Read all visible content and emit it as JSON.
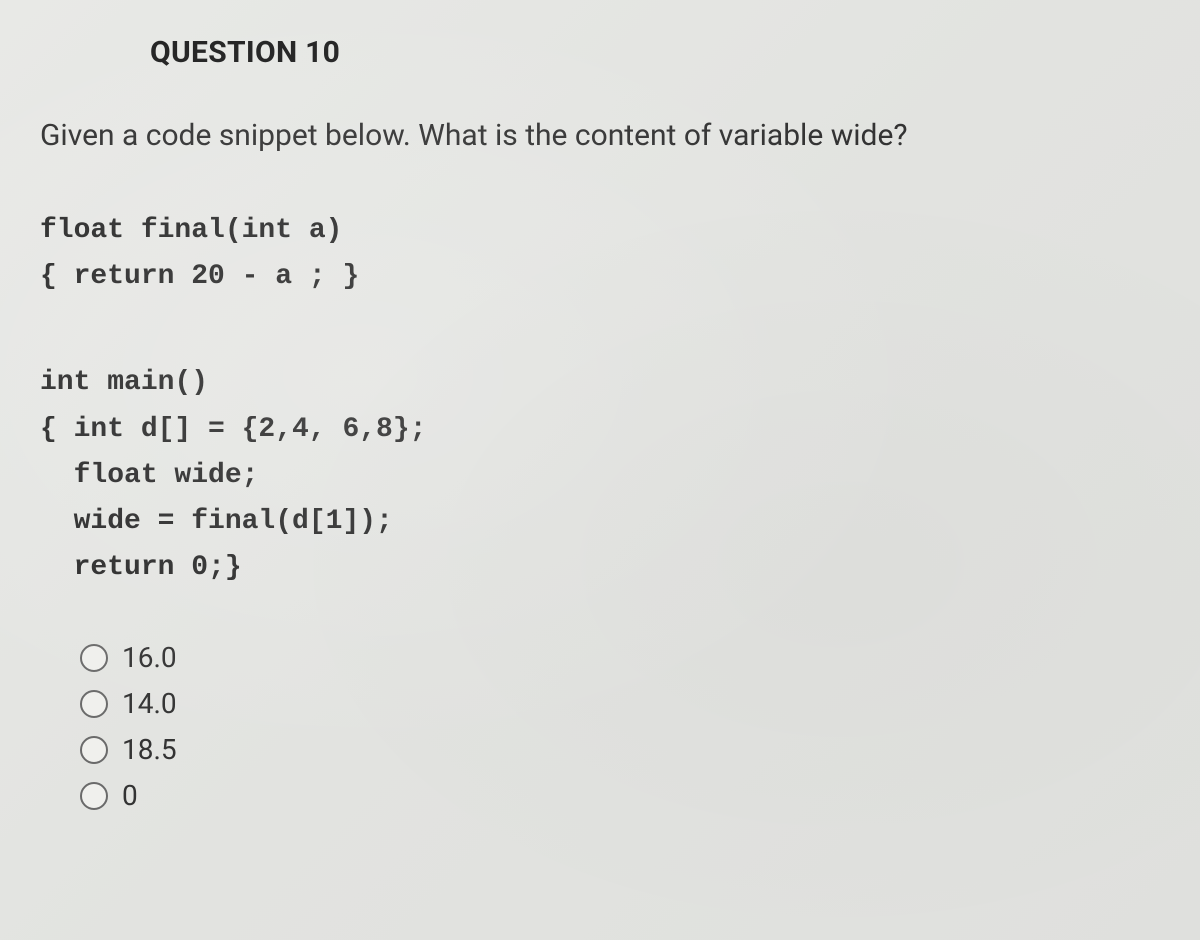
{
  "question": {
    "title": "QUESTION 10",
    "prompt": "Given a code snippet below. What is the content of variable wide?"
  },
  "code": {
    "block1": {
      "line1": "float final(int a)",
      "line2": "{ return 20 - a ; }"
    },
    "block2": {
      "line1": "int main()",
      "line2": "{ int d[] = {2,4, 6,8};",
      "line3": "  float wide;",
      "line4": "  wide = final(d[1]);",
      "line5": "  return 0;}"
    }
  },
  "options": [
    {
      "label": "16.0"
    },
    {
      "label": "14.0"
    },
    {
      "label": "18.5"
    },
    {
      "label": "0"
    }
  ]
}
